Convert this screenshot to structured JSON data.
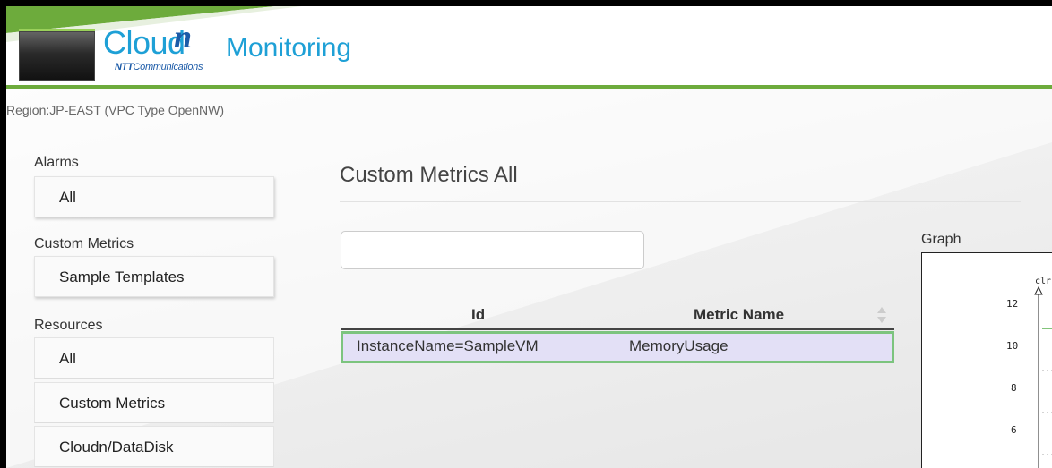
{
  "header": {
    "logo_word": "Cloud",
    "logo_superscript": "n",
    "logo_company_bold": "NTT",
    "logo_company": "Communications",
    "product_name": "Monitoring"
  },
  "region_label": "Region:JP-EAST (VPC Type OpenNW)",
  "sidebar": {
    "alarms": {
      "heading": "Alarms",
      "items": [
        {
          "label": "All"
        }
      ]
    },
    "custom_metrics": {
      "heading": "Custom Metrics",
      "items": [
        {
          "label": "Sample Templates"
        }
      ]
    },
    "resources": {
      "heading": "Resources",
      "items": [
        {
          "label": "All"
        },
        {
          "label": "Custom Metrics"
        },
        {
          "label": "Cloudn/DataDisk"
        }
      ]
    }
  },
  "main": {
    "title": "Custom Metrics All",
    "search": {
      "value": "",
      "placeholder": ""
    },
    "table": {
      "columns": [
        "Id",
        "Metric Name"
      ],
      "rows": [
        {
          "id": "InstanceName=SampleVM",
          "metric_name": "MemoryUsage"
        }
      ]
    }
  },
  "graph": {
    "label": "Graph",
    "caption": "clr",
    "y_ticks": [
      "12",
      "10",
      "8",
      "6"
    ]
  },
  "colors": {
    "brand_blue": "#1ea0d6",
    "brand_green": "#6dab3c",
    "row_selected_bg": "#e3e0f6",
    "row_selected_border": "#7cc47e"
  }
}
